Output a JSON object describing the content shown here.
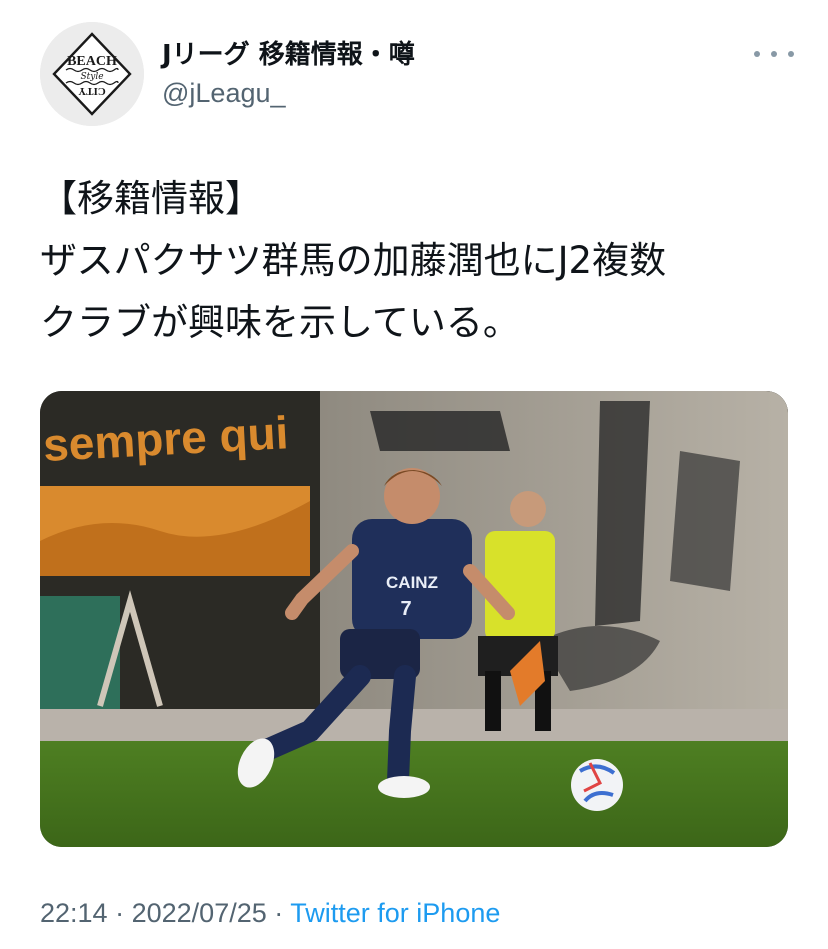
{
  "tweet": {
    "display_name": "Jリーグ 移籍情報・噂",
    "handle": "@jLeagu_",
    "avatar_icon": "beach-style-city-logo-icon",
    "avatar_text": {
      "top": "BEACH",
      "middle": "Style",
      "bottom": "CITY"
    },
    "more_icon": "more-options-icon",
    "text_lines": [
      "【移籍情報】",
      "ザスパクサツ群馬の加藤潤也にJ2複数",
      "クラブが興味を示している。"
    ],
    "media": {
      "description_icon": "soccer-player-photo",
      "banner_text": "sempre qui",
      "jersey_sponsor": "CAINZ",
      "jersey_number": "7"
    },
    "time": "22:14",
    "separator": "·",
    "date": "2022/07/25",
    "source": "Twitter for iPhone"
  },
  "colors": {
    "text_primary": "#0f1419",
    "text_secondary": "#536471",
    "link": "#1d9bf0"
  }
}
